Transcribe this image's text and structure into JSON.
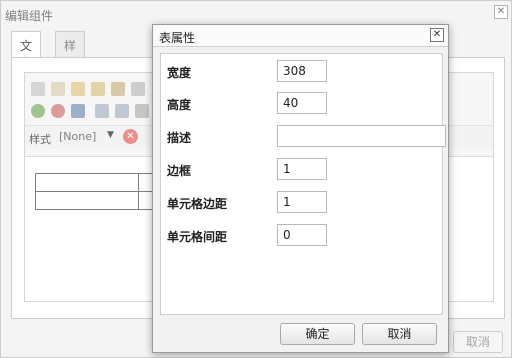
{
  "background_dialog": {
    "title": "编辑组件",
    "close_glyph": "✕",
    "tabs": [
      {
        "label": "文本",
        "active": true
      },
      {
        "label": "样式",
        "active": false
      }
    ],
    "editor": {
      "style_label": "样式",
      "style_select_value": "[None]",
      "style_select_arrow": "▼",
      "remove_glyph": "✕",
      "table_rows": 2,
      "table_cols": 3
    },
    "cancel_button_label": "取消"
  },
  "modal": {
    "title": "表属性",
    "close_glyph": "✕",
    "fields": [
      {
        "label": "宽度",
        "value": "308"
      },
      {
        "label": "高度",
        "value": "40"
      },
      {
        "label": "描述",
        "value": ""
      },
      {
        "label": "边框",
        "value": "1"
      },
      {
        "label": "单元格边距",
        "value": "1"
      },
      {
        "label": "单元格间距",
        "value": "0"
      }
    ],
    "ok_button_label": "确定",
    "cancel_button_label": "取消"
  },
  "colors": {
    "remove_icon": "#e06b6b",
    "modal_border": "#9a9a9a"
  }
}
